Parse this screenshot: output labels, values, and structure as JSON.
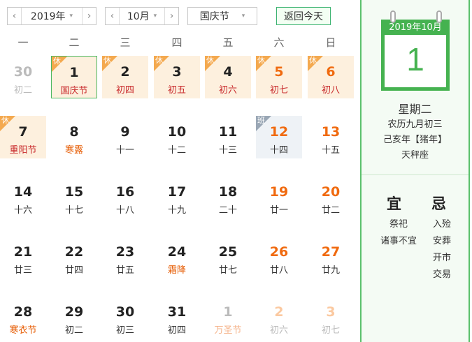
{
  "toolbar": {
    "year_value": "2019年",
    "month_value": "10月",
    "holiday_value": "国庆节",
    "today_label": "返回今天",
    "prev_glyph": "‹",
    "next_glyph": "›",
    "caret_glyph": "▾"
  },
  "weekdays": [
    "一",
    "二",
    "三",
    "四",
    "五",
    "六",
    "日"
  ],
  "weeks": [
    [
      {
        "day": "30",
        "sub": "初二",
        "other": true
      },
      {
        "day": "1",
        "sub": "国庆节",
        "badge": "休",
        "selected": true,
        "subClass": "red"
      },
      {
        "day": "2",
        "sub": "初四",
        "badge": "休",
        "subClass": "red"
      },
      {
        "day": "3",
        "sub": "初五",
        "badge": "休",
        "subClass": "red"
      },
      {
        "day": "4",
        "sub": "初六",
        "badge": "休",
        "subClass": "red"
      },
      {
        "day": "5",
        "sub": "初七",
        "badge": "休",
        "weekend": true,
        "subClass": "red"
      },
      {
        "day": "6",
        "sub": "初八",
        "badge": "休",
        "weekend": true,
        "subClass": "red"
      }
    ],
    [
      {
        "day": "7",
        "sub": "重阳节",
        "badge": "休",
        "subClass": "red"
      },
      {
        "day": "8",
        "sub": "寒露",
        "subClass": "fest"
      },
      {
        "day": "9",
        "sub": "十一"
      },
      {
        "day": "10",
        "sub": "十二"
      },
      {
        "day": "11",
        "sub": "十三"
      },
      {
        "day": "12",
        "sub": "十四",
        "badge": "班",
        "weekend": true
      },
      {
        "day": "13",
        "sub": "十五",
        "weekend": true
      }
    ],
    [
      {
        "day": "14",
        "sub": "十六"
      },
      {
        "day": "15",
        "sub": "十七"
      },
      {
        "day": "16",
        "sub": "十八"
      },
      {
        "day": "17",
        "sub": "十九"
      },
      {
        "day": "18",
        "sub": "二十"
      },
      {
        "day": "19",
        "sub": "廿一",
        "weekend": true
      },
      {
        "day": "20",
        "sub": "廿二",
        "weekend": true
      }
    ],
    [
      {
        "day": "21",
        "sub": "廿三"
      },
      {
        "day": "22",
        "sub": "廿四"
      },
      {
        "day": "23",
        "sub": "廿五"
      },
      {
        "day": "24",
        "sub": "霜降",
        "subClass": "fest"
      },
      {
        "day": "25",
        "sub": "廿七"
      },
      {
        "day": "26",
        "sub": "廿八",
        "weekend": true
      },
      {
        "day": "27",
        "sub": "廿九",
        "weekend": true
      }
    ],
    [
      {
        "day": "28",
        "sub": "寒衣节",
        "subClass": "fest"
      },
      {
        "day": "29",
        "sub": "初二"
      },
      {
        "day": "30",
        "sub": "初三"
      },
      {
        "day": "31",
        "sub": "初四"
      },
      {
        "day": "1",
        "sub": "万圣节",
        "other": true,
        "subClass": "fest"
      },
      {
        "day": "2",
        "sub": "初六",
        "other": true,
        "weekend": true
      },
      {
        "day": "3",
        "sub": "初七",
        "other": true,
        "weekend": true
      }
    ]
  ],
  "side": {
    "header": "2019年10月",
    "day": "1",
    "weekday": "星期二",
    "lunar": "农历九月初三",
    "ganzhi": "己亥年【猪年】",
    "zodiac": "天秤座",
    "yi_title": "宜",
    "ji_title": "忌",
    "yi_items": [
      "祭祀",
      "诸事不宜"
    ],
    "ji_items": [
      "入殓",
      "安葬",
      "开市",
      "交易"
    ]
  },
  "colors": {
    "accent_green": "#45b250",
    "weekend_orange": "#f06a0f",
    "holiday_bg": "#fdf0de",
    "holiday_badge": "#f4a94f",
    "workday_badge": "#9aa7b5"
  }
}
